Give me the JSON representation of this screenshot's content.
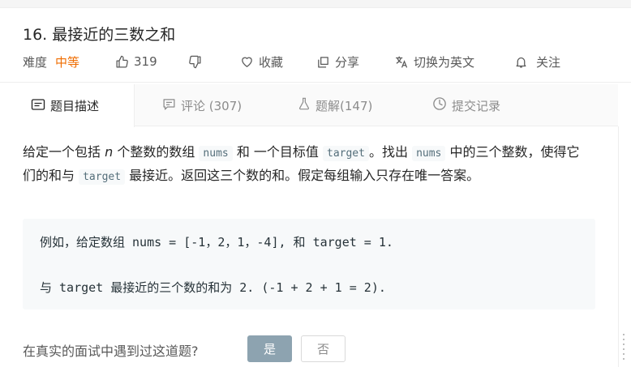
{
  "problem": {
    "title": "16. 最接近的三数之和",
    "difficulty_label": "难度",
    "difficulty_value": "中等",
    "likes": "319",
    "favorite_label": "收藏",
    "share_label": "分享",
    "switch_lang_label": "切换为英文",
    "follow_label": "关注"
  },
  "tabs": {
    "description": "题目描述",
    "comments": "评论 (307)",
    "solutions": "题解(147)",
    "submissions": "提交记录"
  },
  "description": {
    "p1": "给定一个包括 ",
    "n": "n",
    "p2": " 个整数的数组 ",
    "nums1": "nums",
    "p3": " 和 一个目标值 ",
    "target1": "target",
    "p4": "。找出 ",
    "nums2": "nums",
    "p5": " 中的三个整数，使得它们的和与 ",
    "target2": "target",
    "p6": " 最接近。返回这三个数的和。假定每组输入只存在唯一答案。"
  },
  "example": {
    "line1": "例如，给定数组 nums = [-1，2，1，-4], 和 target = 1.",
    "line2": "与 target 最接近的三个数的和为 2. (-1 + 2 + 1 = 2)."
  },
  "interview": {
    "question": "在真实的面试中遇到过这道题?",
    "yes": "是",
    "no": "否"
  }
}
